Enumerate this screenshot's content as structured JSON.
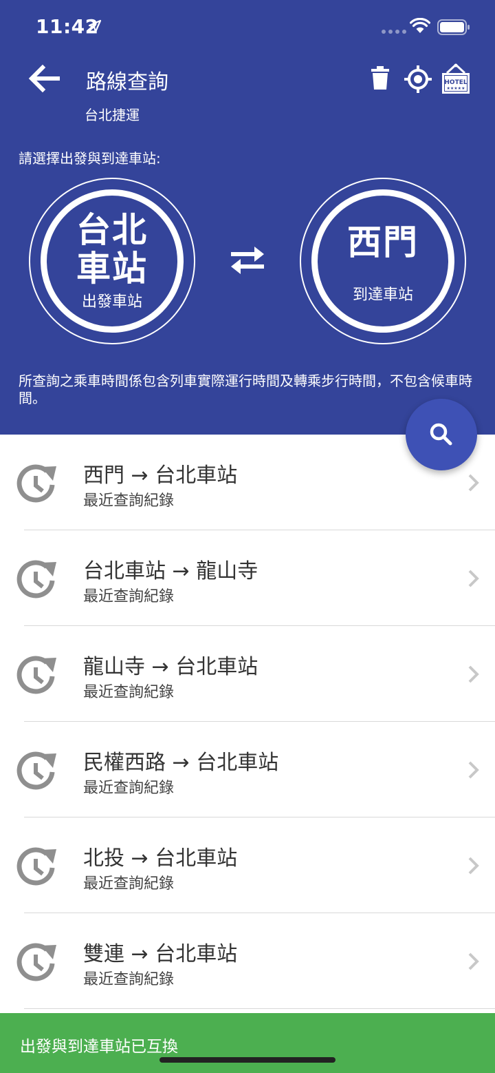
{
  "status": {
    "time": "11:42"
  },
  "header": {
    "title": "路線查詢",
    "subtitle": "台北捷運",
    "prompt": "請選擇出發與到達車站:",
    "note": "所查詢之乘車時間係包含列車實際運行時間及轉乘步行時間，不包含候車時間。"
  },
  "from": {
    "name": "台北車站",
    "label": "出發車站"
  },
  "to": {
    "name": "西門",
    "label": "到達車站"
  },
  "history": [
    {
      "route": "西門 → 台北車站",
      "sub": "最近查詢紀錄"
    },
    {
      "route": "台北車站 → 龍山寺",
      "sub": "最近查詢紀錄"
    },
    {
      "route": "龍山寺 → 台北車站",
      "sub": "最近查詢紀錄"
    },
    {
      "route": "民權西路 → 台北車站",
      "sub": "最近查詢紀錄"
    },
    {
      "route": "北投 → 台北車站",
      "sub": "最近查詢紀錄"
    },
    {
      "route": "雙連 → 台北車站",
      "sub": "最近查詢紀錄"
    }
  ],
  "toast": {
    "text": "出發與到達車站已互換"
  },
  "icons": {
    "back": "arrow-left-icon",
    "trash": "trash-icon",
    "locate": "crosshair-icon",
    "hotel": "hotel-sign-icon",
    "swap": "swap-arrows-icon",
    "search": "search-icon",
    "history": "history-icon",
    "chevron": "chevron-right-icon"
  },
  "colors": {
    "primary": "#34449a",
    "fab": "#3e51b5",
    "toast": "#4caf50"
  }
}
